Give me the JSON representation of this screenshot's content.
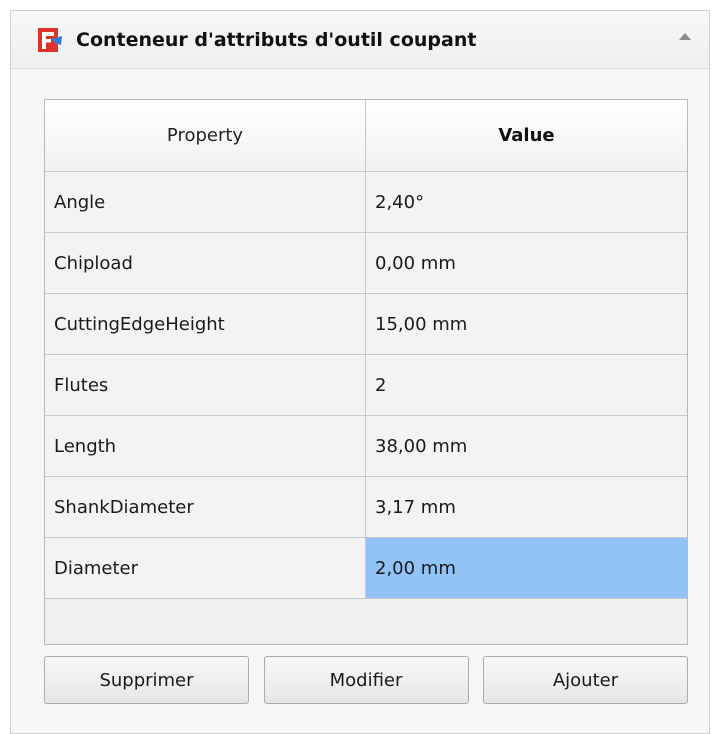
{
  "panel": {
    "title": "Conteneur d'attributs d'outil coupant",
    "logo_icon": "freecad-logo-icon",
    "collapse_icon": "collapse-arrow-up-icon"
  },
  "table": {
    "headers": {
      "property": "Property",
      "value": "Value"
    },
    "rows": [
      {
        "property": "Angle",
        "value": "2,40°"
      },
      {
        "property": "Chipload",
        "value": "0,00 mm"
      },
      {
        "property": "CuttingEdgeHeight",
        "value": "15,00 mm"
      },
      {
        "property": "Flutes",
        "value": "2"
      },
      {
        "property": "Length",
        "value": "38,00 mm"
      },
      {
        "property": "ShankDiameter",
        "value": "3,17 mm"
      },
      {
        "property": "Diameter",
        "value": "2,00 mm"
      }
    ],
    "selection_color": "#91c3f7"
  },
  "buttons": {
    "delete": "Supprimer",
    "edit": "Modifier",
    "add": "Ajouter"
  }
}
